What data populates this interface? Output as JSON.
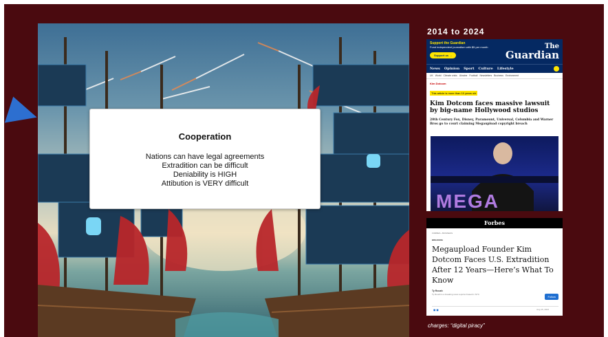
{
  "slide": {
    "card": {
      "title": "Cooperation",
      "lines": [
        "Nations can have legal agreements",
        "Extradition can be difficult",
        "Deniability is HIGH",
        "Attibution is VERY difficult"
      ]
    },
    "timeline_label": "2014 to 2024",
    "caption": "charges: “digital piracy”"
  },
  "guardian": {
    "support_title": "Support the Guardian",
    "support_text": "Fund independent journalism with $5 per month",
    "support_button": "Support us →",
    "logo_the": "The",
    "logo_main": "Guardian",
    "nav": [
      "News",
      "Opinion",
      "Sport",
      "Culture",
      "Lifestyle"
    ],
    "subnav": [
      "UK",
      "World",
      "Climate crisis",
      "Ukraine",
      "Football",
      "Newsletters",
      "Business",
      "Environment"
    ],
    "kicker": "Kim Dotcom",
    "age_notice": "This article is more than 10 years old",
    "headline": "Kim Dotcom faces massive lawsuit by big-name Hollywood studios",
    "standfirst": "20th Century Fox, Disney, Paramount, Universal, Columbia and Warner Bros go to court claiming Megaupload copyright breach",
    "photo_text": "MEGA"
  },
  "forbes": {
    "logo": "Forbes",
    "meta": "FORBES › BUSINESS",
    "section": "BREAKING",
    "headline": "Megaupload Founder Kim Dotcom Faces U.S. Extradition After 12 Years—Here’s What To Know",
    "author": "Ty Roush",
    "author_detail": "Ty Roush is a breaking news reporter based in NYC",
    "follow_button": "Follow",
    "date": "Aug 15, 2024"
  },
  "colors": {
    "slide_bg": "#4a0a0f",
    "pointer": "#2d6fd0",
    "guardian_blue": "#052962",
    "guardian_yellow": "#ffe500"
  }
}
